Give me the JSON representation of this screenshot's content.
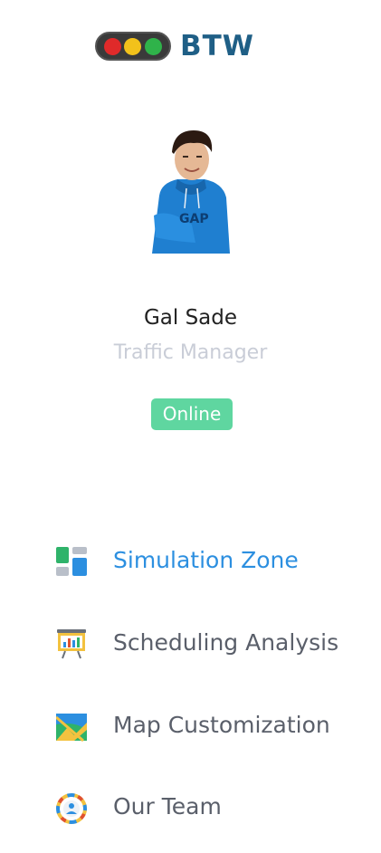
{
  "brand": {
    "name": "BTW",
    "traffic_light_colors": [
      "#e02a2a",
      "#f2c21b",
      "#2fb34a"
    ],
    "text_color": "#1f5f86"
  },
  "profile": {
    "name": "Gal Sade",
    "role": "Traffic Manager",
    "status": "Online",
    "status_color": "#5fd6a0"
  },
  "nav": {
    "items": [
      {
        "label": "Simulation Zone",
        "icon": "dashboard-icon",
        "active": true
      },
      {
        "label": "Scheduling Analysis",
        "icon": "presentation-chart-icon",
        "active": false
      },
      {
        "label": "Map Customization",
        "icon": "map-icon",
        "active": false
      },
      {
        "label": "Our Team",
        "icon": "team-circle-icon",
        "active": false
      }
    ],
    "active_color": "#2c8fe0",
    "inactive_color": "#5a5f6a"
  }
}
